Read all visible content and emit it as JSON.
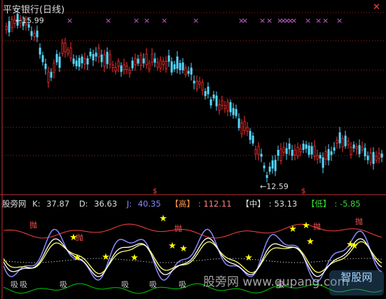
{
  "window": {
    "title": "平安银行(日线)",
    "corner_icon": "close-x-icon"
  },
  "main_chart": {
    "high_label": "15.99",
    "low_label": "12.59",
    "arrow_high": "←",
    "arrow_low": "←",
    "up_color": "#ff3030",
    "down_color": "#54d8ff",
    "xi_marker": "×",
    "xi_color": "#d060d0",
    "sell_marker": "$"
  },
  "indicator": {
    "name": "股旁网",
    "k_label": "K:",
    "k_value": "37.87",
    "d_label": "D:",
    "d_value": "36.63",
    "j_label": "J:",
    "j_value": "40.35",
    "high_label": "【高】",
    "high_value": "112.11",
    "mid_label": "【中】",
    "mid_value": "53.13",
    "low_label": "【低】",
    "low_value": "-5.85",
    "sell_text": "抛",
    "buy_text": "吸",
    "star": "★"
  },
  "watermark": {
    "text": "股旁网 www.gupang.com",
    "logo_text": "智股网"
  },
  "colors": {
    "k_color": "#ffffff",
    "d_color": "#ffff66",
    "j_color": "#8888ff",
    "high_color": "#ff4040",
    "mid_color": "#ffffff",
    "low_color": "#00cc00",
    "star_color": "#ffff00"
  }
}
